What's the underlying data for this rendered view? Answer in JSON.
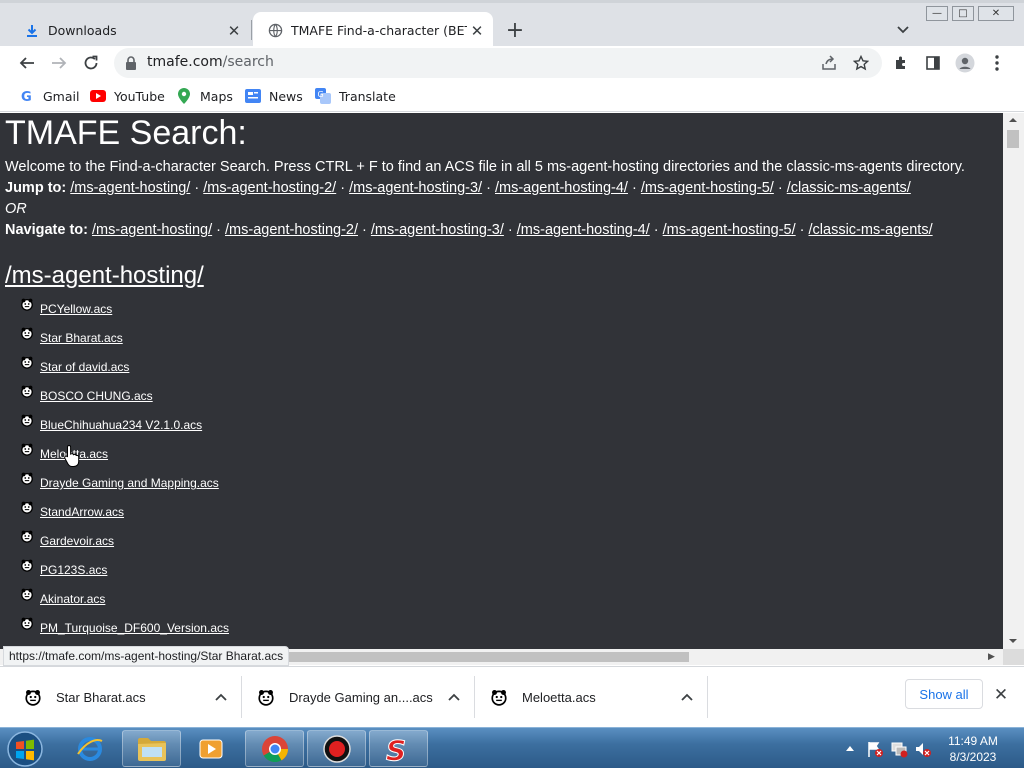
{
  "window": {
    "minimize": "—",
    "maximize": "□",
    "close": "✕"
  },
  "tabs": [
    {
      "label": "Downloads",
      "icon": "download-icon"
    },
    {
      "label": "TMAFE Find-a-character (BETA)",
      "icon": "globe-icon",
      "active": true
    }
  ],
  "toolbar": {
    "url_host": "tmafe.com",
    "url_path": "/search"
  },
  "bookmarks": [
    {
      "label": "Gmail",
      "icon": "gmail-icon"
    },
    {
      "label": "YouTube",
      "icon": "youtube-icon"
    },
    {
      "label": "Maps",
      "icon": "maps-icon"
    },
    {
      "label": "News",
      "icon": "news-icon"
    },
    {
      "label": "Translate",
      "icon": "translate-icon"
    }
  ],
  "page": {
    "title": "TMAFE Search:",
    "welcome": "Welcome to the Find-a-character Search. Press CTRL + F to find an ACS file in all 5 ms-agent-hosting directories and the classic-ms-agents directory.",
    "jump_label": "Jump to:",
    "or_label": "OR",
    "navigate_label": "Navigate to:",
    "separator": " · ",
    "dirs": [
      "/ms-agent-hosting/",
      "/ms-agent-hosting-2/",
      "/ms-agent-hosting-3/",
      "/ms-agent-hosting-4/",
      "/ms-agent-hosting-5/",
      "/classic-ms-agents/"
    ],
    "section_title": "/ms-agent-hosting/",
    "files": [
      "PCYellow.acs",
      "Star Bharat.acs",
      "Star of david.acs",
      "BOSCO CHUNG.acs",
      "BlueChihuahua234 V2.1.0.acs",
      "Meloetta.acs",
      "Drayde Gaming and Mapping.acs",
      "StandArrow.acs",
      "Gardevoir.acs",
      "PG123S.acs",
      "Akinator.acs",
      "PM_Turquoise_DF600_Version.acs"
    ]
  },
  "status_bar": {
    "url": "https://tmafe.com/ms-agent-hosting/Star Bharat.acs"
  },
  "downloads": [
    {
      "label": "Star Bharat.acs",
      "icon": "agent-file-icon"
    },
    {
      "label": "Drayde Gaming an....acs",
      "icon": "agent-file-icon"
    },
    {
      "label": "Meloetta.acs",
      "icon": "agent-file-icon"
    }
  ],
  "downloads_bar": {
    "show_all": "Show all"
  },
  "taskbar": {
    "apps": [
      "internet-explorer-icon",
      "file-explorer-icon",
      "media-player-icon",
      "chrome-icon",
      "record-icon",
      "s-app-icon"
    ],
    "time": "11:49 AM",
    "date": "8/3/2023"
  }
}
